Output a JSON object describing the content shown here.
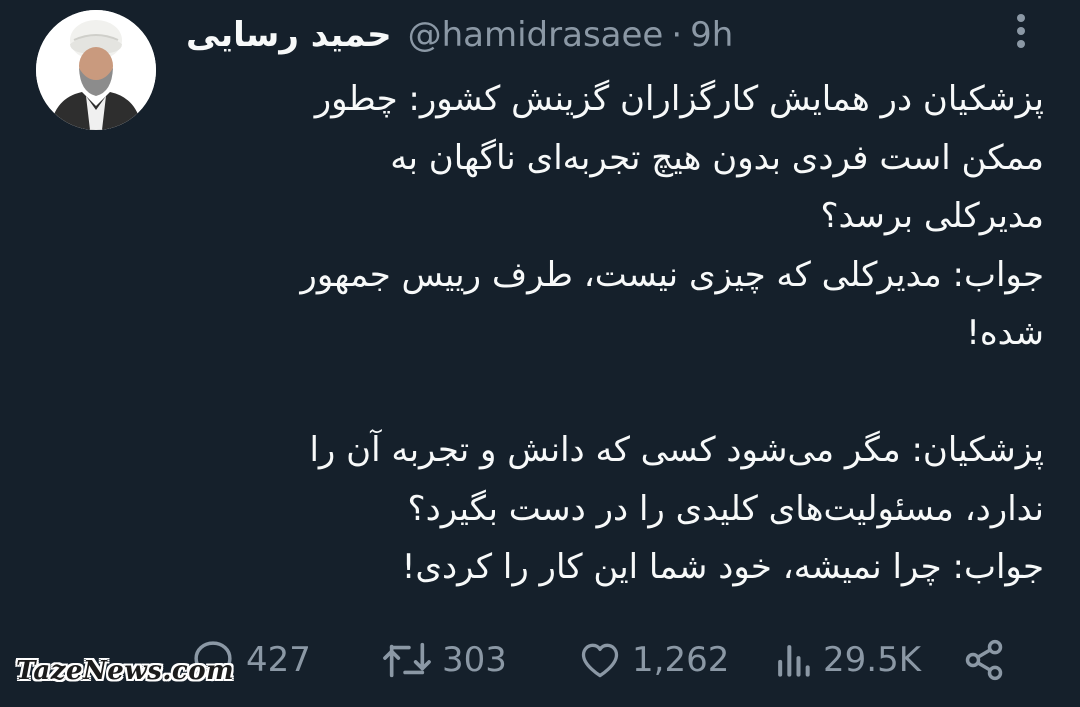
{
  "tweet": {
    "display_name": "حمید رسایی",
    "handle": "@hamidrasaee",
    "separator": "·",
    "time": "9h",
    "lines": [
      "پزشکیان در همایش کارگزاران گزینش کشور: چطور",
      "ممکن است فردی بدون هیچ تجربه‌ای ناگهان به",
      "مدیرکلی برسد؟",
      "جواب: مدیرکلی که چیزی نیست، طرف رییس جمهور",
      "شده!",
      "",
      "پزشکیان: مگر می‌شود کسی که دانش و تجربه آن را",
      "ندارد، مسئولیت‌های کلیدی را در دست بگیرد؟",
      "جواب: چرا نمیشه، خود شما این کار را کردی!"
    ]
  },
  "actions": {
    "reply_count": "427",
    "retweet_count": "303",
    "like_count": "1,262",
    "views_count": "29.5K"
  },
  "icons": {
    "more": "more-vertical-icon",
    "reply": "reply-bubble-icon",
    "retweet": "retweet-icon",
    "like": "heart-icon",
    "views": "views-bar-chart-icon",
    "share": "share-icon"
  },
  "watermark": "TazeNews.com",
  "colors": {
    "background": "#15202b",
    "text": "#f7f9f9",
    "muted": "#8b98a5"
  }
}
